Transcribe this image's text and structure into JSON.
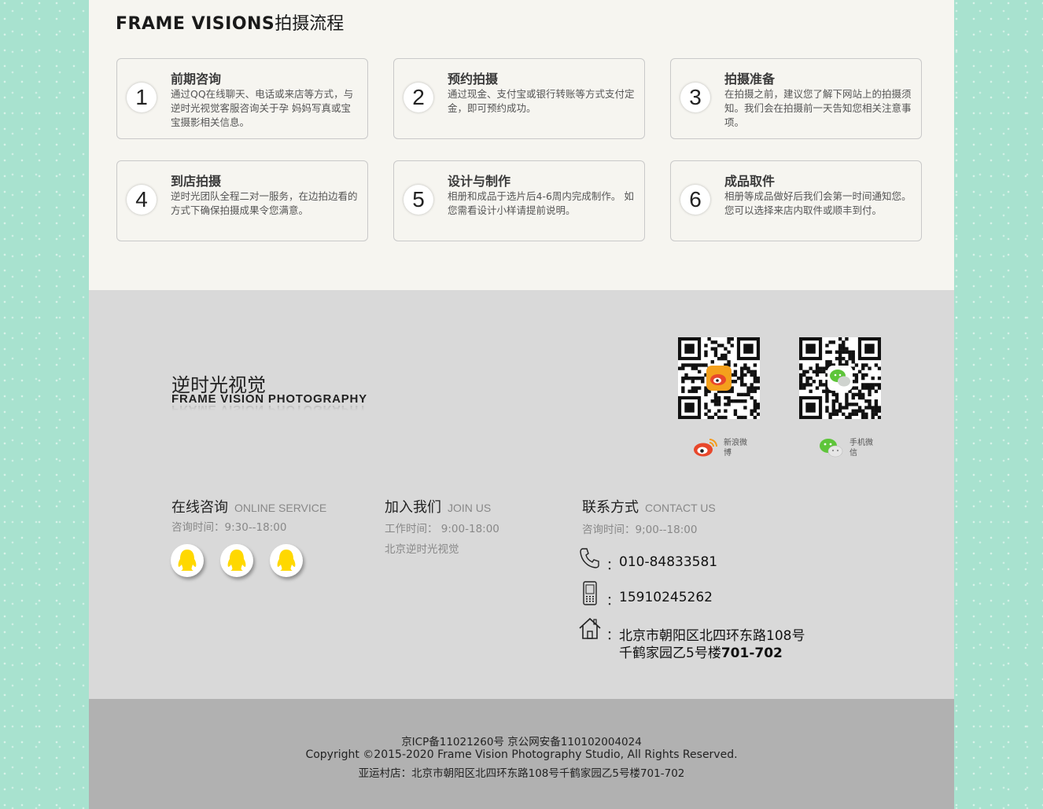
{
  "process": {
    "title_en": "FRAME VISIONS",
    "title_zh": "拍摄流程",
    "steps": [
      {
        "num": "1",
        "title": "前期咨询",
        "desc": "通过QQ在线聊天、电话或来店等方式，与逆时光视觉客服咨询关于孕 妈妈写真或宝宝摄影相关信息。"
      },
      {
        "num": "2",
        "title": "预约拍摄",
        "desc": "通过现金、支付宝或银行转账等方式支付定金，即可预约成功。"
      },
      {
        "num": "3",
        "title": "拍摄准备",
        "desc": "在拍摄之前，建议您了解下网站上的拍摄须知。我们会在拍摄前一天告知您相关注意事项。"
      },
      {
        "num": "4",
        "title": "到店拍摄",
        "desc": "逆时光团队全程二对一服务，在边拍边看的方式下确保拍摄成果令您满意。"
      },
      {
        "num": "5",
        "title": "设计与制作",
        "desc": "相册和成品于选片后4-6周内完成制作。 如您需看设计小样请提前说明。"
      },
      {
        "num": "6",
        "title": "成品取件",
        "desc": "相册等成品做好后我们会第一时间通知您。您可以选择来店内取件或顺丰到付。"
      }
    ]
  },
  "brand": {
    "zh": "逆时光视觉",
    "en": "FRAME VISION PHOTOGRAPHY"
  },
  "qr": {
    "weibo": {
      "caption": "新浪微博",
      "icon": "weibo-icon",
      "color": "#e8472b"
    },
    "wechat": {
      "caption": "手机微信",
      "icon": "wechat-icon",
      "color": "#5ec53a"
    }
  },
  "online": {
    "title_zh": "在线咨询",
    "title_en": "ONLINE SERVICE",
    "hours": "咨询时间：9:30--18:00",
    "qq_icon": "qq-icon",
    "qq_color": "#ffd800"
  },
  "join": {
    "title_zh": "加入我们",
    "title_en": "JOIN US",
    "hours": "工作时间： 9:00-18:00",
    "name": "北京逆时光视觉"
  },
  "contact": {
    "title_zh": "联系方式",
    "title_en": "CONTACT US",
    "hours": "咨询时间：9;00--18:00",
    "phone": "010-84833581",
    "mobile": "15910245262",
    "address1": "北京市朝阳区北四环东路108号",
    "address2_a": "千鹤家园乙5号楼",
    "address2_b": "701-702",
    "colon": "："
  },
  "footer": {
    "icp": "京ICP备11021260号 京公网安备110102004024",
    "copyright": "Copyright ©2015-2020 Frame Vision Photography Studio, All Rights Reserved.",
    "store": "亚运村店：北京市朝阳区北四环东路108号千鹤家园乙5号楼701-702"
  }
}
